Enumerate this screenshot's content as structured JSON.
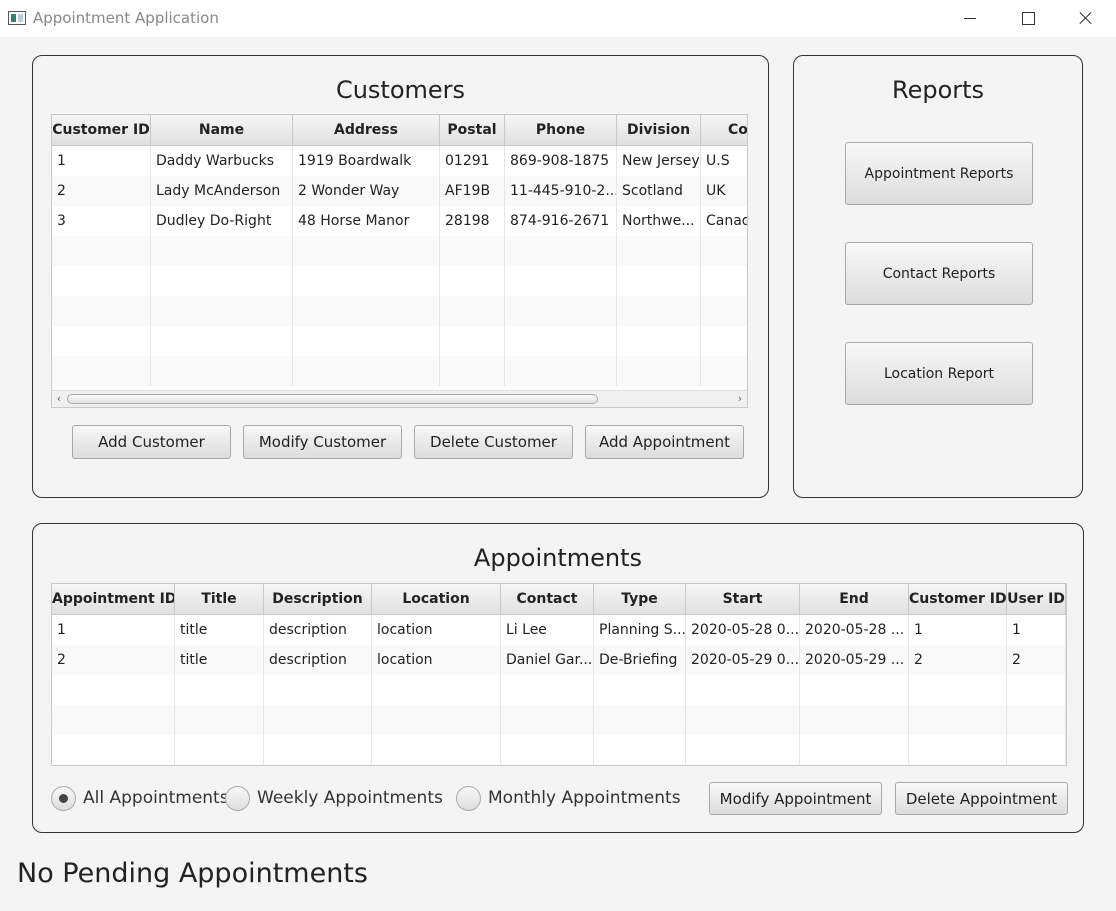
{
  "window": {
    "title": "Appointment Application"
  },
  "customers": {
    "title": "Customers",
    "columns": [
      "Customer ID",
      "Name",
      "Address",
      "Postal",
      "Phone",
      "Division",
      "Co"
    ],
    "rows": [
      [
        "1",
        "Daddy Warbucks",
        "1919 Boardwalk",
        "01291",
        "869-908-1875",
        "New Jersey",
        "U.S"
      ],
      [
        "2",
        "Lady McAnderson",
        "2 Wonder Way",
        "AF19B",
        "11-445-910-2...",
        "Scotland",
        "UK"
      ],
      [
        "3",
        "Dudley Do-Right",
        "48 Horse Manor",
        "28198",
        "874-916-2671",
        "Northwe...",
        "Canada"
      ]
    ],
    "buttons": {
      "add": "Add Customer",
      "modify": "Modify Customer",
      "delete": "Delete Customer",
      "add_appointment": "Add Appointment"
    }
  },
  "reports": {
    "title": "Reports",
    "buttons": {
      "appointment": "Appointment Reports",
      "contact": "Contact Reports",
      "location": "Location Report"
    }
  },
  "appointments": {
    "title": "Appointments",
    "columns": [
      "Appointment ID",
      "Title",
      "Description",
      "Location",
      "Contact",
      "Type",
      "Start",
      "End",
      "Customer ID",
      "User ID"
    ],
    "rows": [
      [
        "1",
        "title",
        "description",
        "location",
        "Li Lee",
        "Planning S...",
        "2020-05-28 0...",
        "2020-05-28 ...",
        "1",
        "1"
      ],
      [
        "2",
        "title",
        "description",
        "location",
        "Daniel Gar...",
        "De-Briefing",
        "2020-05-29 0...",
        "2020-05-29 ...",
        "2",
        "2"
      ]
    ],
    "filters": {
      "all": "All Appointments",
      "weekly": "Weekly Appointments",
      "monthly": "Monthly Appointments",
      "selected": "all"
    },
    "buttons": {
      "modify": "Modify Appointment",
      "delete": "Delete Appointment"
    }
  },
  "status": {
    "message": "No Pending Appointments"
  }
}
